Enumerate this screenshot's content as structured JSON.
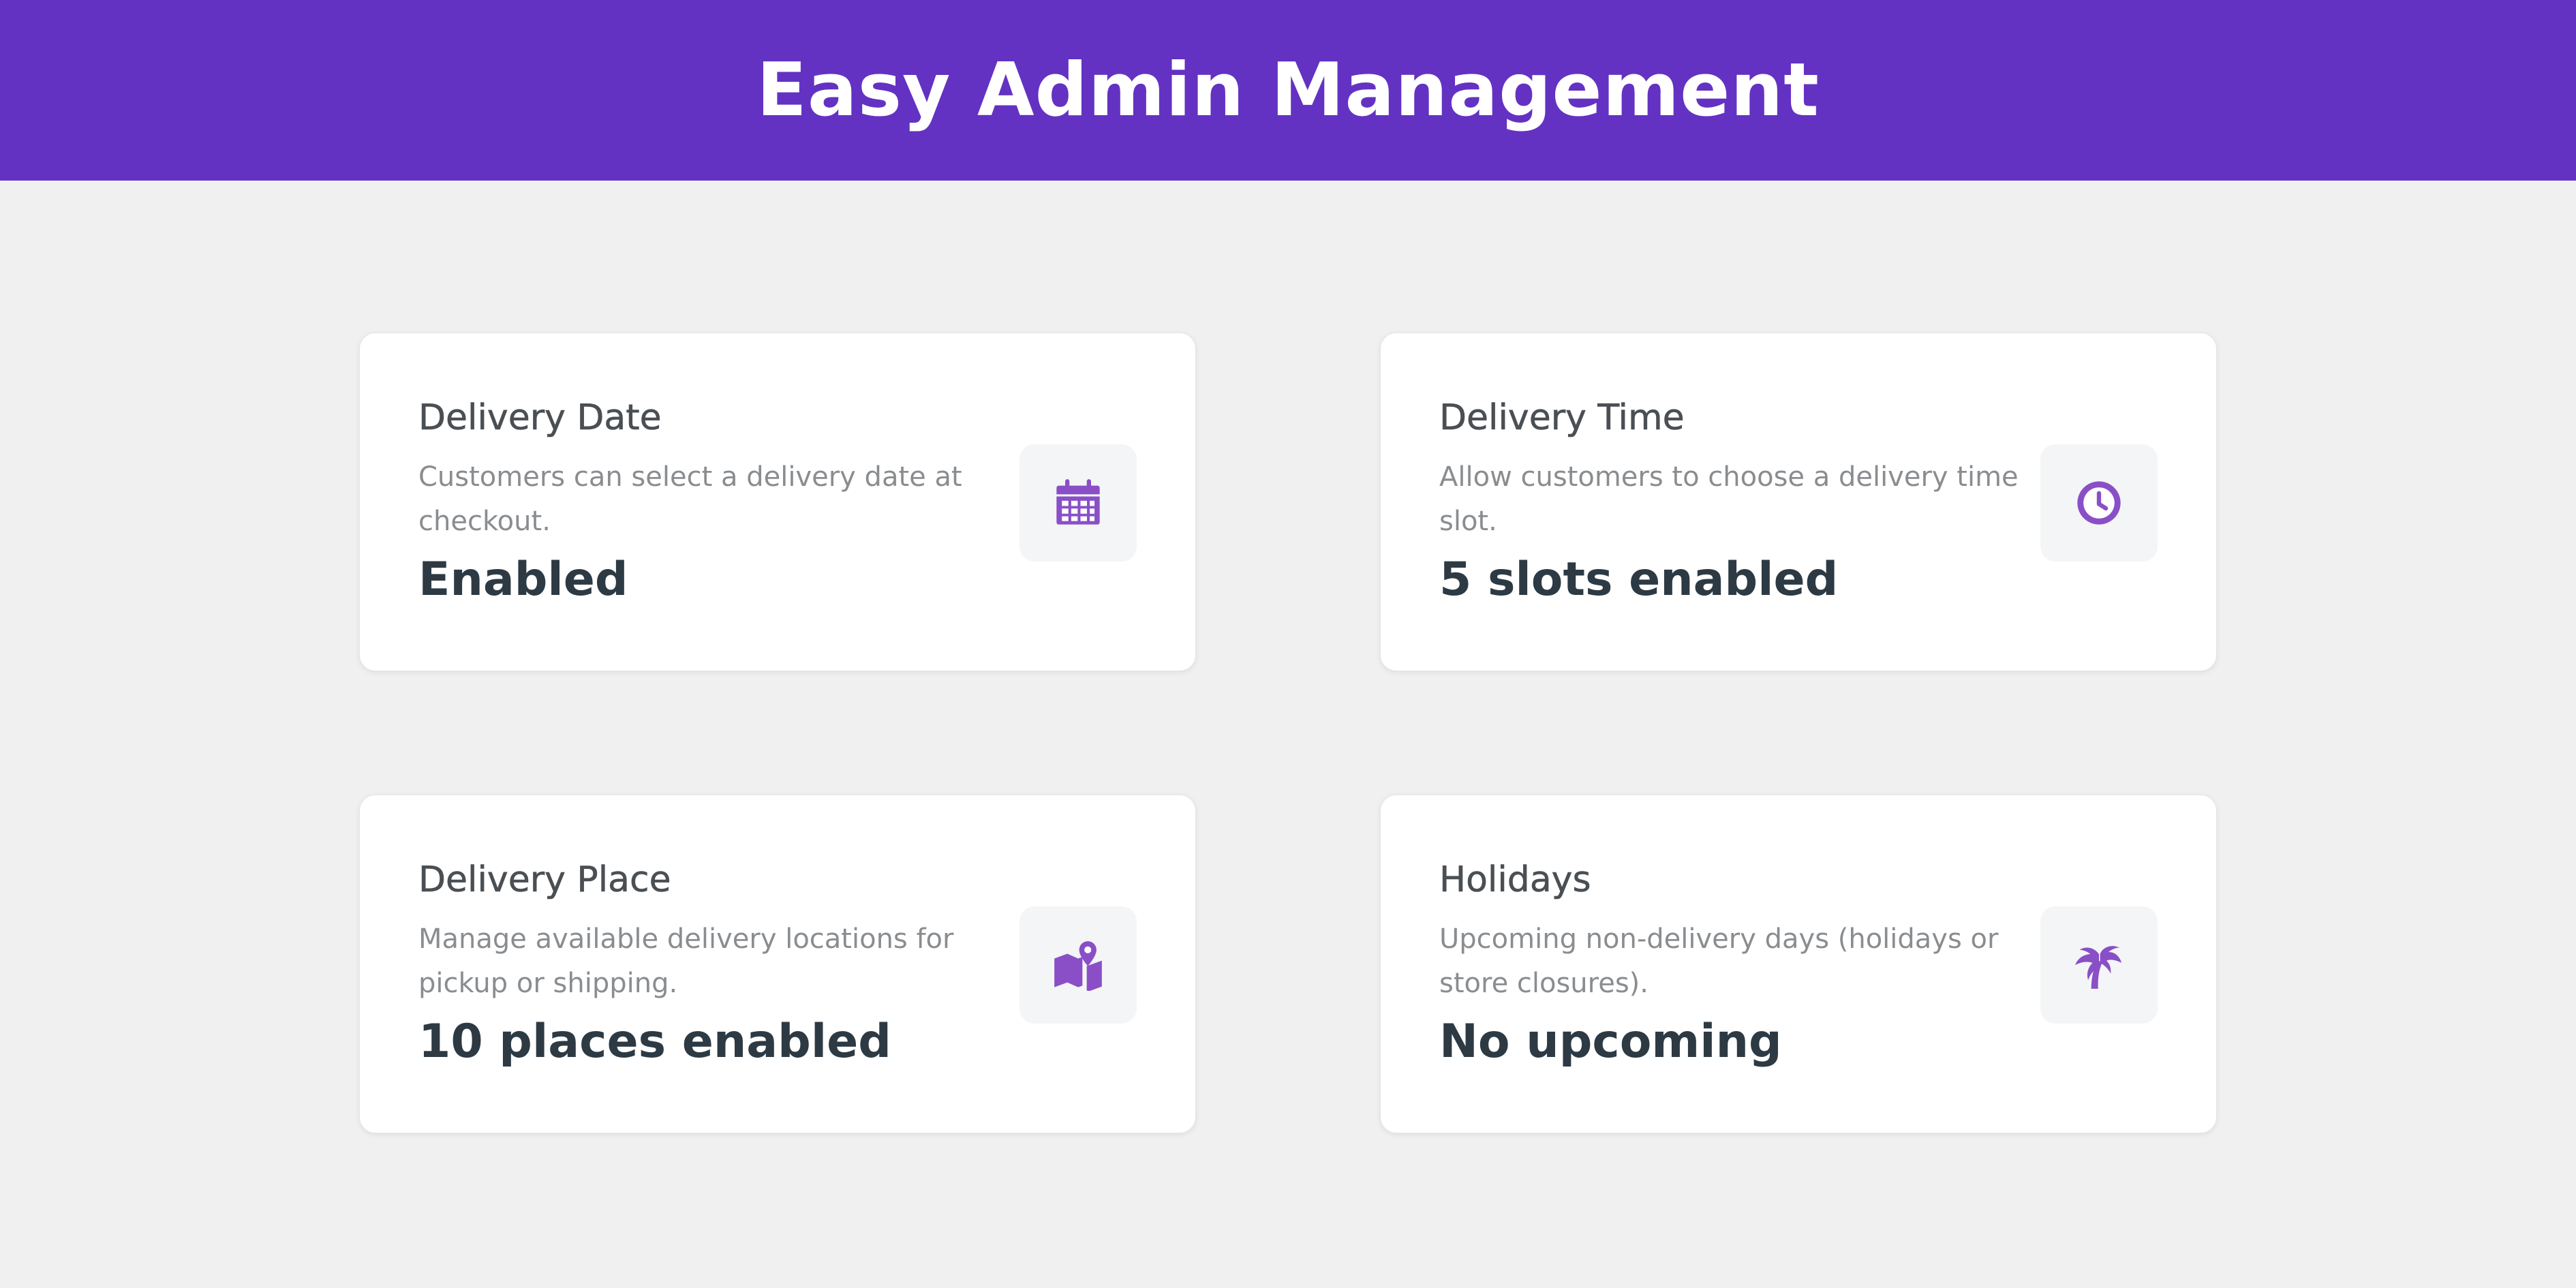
{
  "header": {
    "title": "Easy Admin Management"
  },
  "colors": {
    "header_bg": "#6332c3",
    "icon_accent": "#8a4fc7",
    "page_bg": "#f0f0f0"
  },
  "cards": [
    {
      "title": "Delivery Date",
      "description": "Customers can select a delivery date at checkout.",
      "value": "Enabled",
      "icon": "calendar-icon"
    },
    {
      "title": "Delivery Time",
      "description": "Allow customers to choose a delivery time slot.",
      "value": "5 slots enabled",
      "icon": "clock-icon"
    },
    {
      "title": "Delivery Place",
      "description": "Manage available delivery locations for pickup or shipping.",
      "value": "10 places enabled",
      "icon": "map-pin-icon"
    },
    {
      "title": "Holidays",
      "description": "Upcoming non-delivery days (holidays or store closures).",
      "value": "No upcoming",
      "icon": "palm-tree-icon"
    }
  ]
}
